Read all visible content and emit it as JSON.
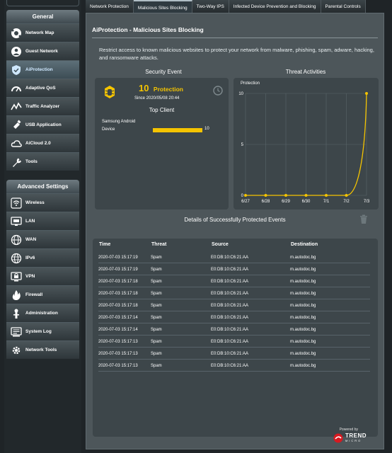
{
  "sidebar": {
    "general_title": "General",
    "general_items": [
      {
        "label": "Network Map",
        "icon": "network-map-icon"
      },
      {
        "label": "Guest Network",
        "icon": "guest-network-icon"
      },
      {
        "label": "AiProtection",
        "icon": "aiprotection-icon"
      },
      {
        "label": "Adaptive QoS",
        "icon": "qos-gauge-icon"
      },
      {
        "label": "Traffic Analyzer",
        "icon": "traffic-analyzer-icon"
      },
      {
        "label": "USB Application",
        "icon": "usb-icon"
      },
      {
        "label": "AiCloud 2.0",
        "icon": "cloud-icon"
      },
      {
        "label": "Tools",
        "icon": "tools-icon"
      }
    ],
    "advanced_title": "Advanced Settings",
    "advanced_items": [
      {
        "label": "Wireless",
        "icon": "wireless-icon"
      },
      {
        "label": "LAN",
        "icon": "lan-icon"
      },
      {
        "label": "WAN",
        "icon": "wan-globe-icon"
      },
      {
        "label": "IPv6",
        "icon": "ipv6-icon"
      },
      {
        "label": "VPN",
        "icon": "vpn-icon"
      },
      {
        "label": "Firewall",
        "icon": "firewall-icon"
      },
      {
        "label": "Administration",
        "icon": "administration-icon"
      },
      {
        "label": "System Log",
        "icon": "system-log-icon"
      },
      {
        "label": "Network Tools",
        "icon": "network-tools-icon"
      }
    ]
  },
  "tabs": [
    "Network Protection",
    "Malicious Sites Blocking",
    "Two-Way IPS",
    "Infected Device Prevention and Blocking",
    "Parental Controls"
  ],
  "page": {
    "title": "AiProtection - Malicious Sites Blocking",
    "description": "Restrict access to known malicious websites to protect your network from malware, phishing, spam, adware, hacking, and ransomware attacks."
  },
  "security_event": {
    "heading": "Security Event",
    "count": "10",
    "count_label": "Protection",
    "since": "Since 2020/05/08 20:44",
    "top_client_heading": "Top Client",
    "client_name_line1": "Samsung Android",
    "client_name_line2": "Device",
    "client_value": 10,
    "client_max": 10
  },
  "threat_activities": {
    "heading": "Threat Activities"
  },
  "chart_data": {
    "type": "line",
    "title": "Protection",
    "categories": [
      "6/27",
      "6/28",
      "6/29",
      "6/30",
      "7/1",
      "7/2",
      "7/3"
    ],
    "series": [
      {
        "values": [
          0,
          0,
          0,
          0,
          0,
          0,
          10
        ]
      }
    ],
    "yticks": [
      "0",
      "5",
      "10"
    ],
    "ylim": [
      0,
      10
    ],
    "grid": true
  },
  "details": {
    "heading": "Details of Successfully Protected Events",
    "columns": [
      "Time",
      "Threat",
      "Source",
      "Destination"
    ],
    "rows": [
      [
        "2020-07-03 15:17:19",
        "Spam",
        "E0:DB:10:C6:21:AA",
        "m.autodoc.bg"
      ],
      [
        "2020-07-03 15:17:19",
        "Spam",
        "E0:DB:10:C6:21:AA",
        "m.autodoc.bg"
      ],
      [
        "2020-07-03 15:17:18",
        "Spam",
        "E0:DB:10:C6:21:AA",
        "m.autodoc.bg"
      ],
      [
        "2020-07-03 15:17:18",
        "Spam",
        "E0:DB:10:C6:21:AA",
        "m.autodoc.bg"
      ],
      [
        "2020-07-03 15:17:18",
        "Spam",
        "E0:DB:10:C6:21:AA",
        "m.autodoc.bg"
      ],
      [
        "2020-07-03 15:17:14",
        "Spam",
        "E0:DB:10:C6:21:AA",
        "m.autodoc.bg"
      ],
      [
        "2020-07-03 15:17:14",
        "Spam",
        "E0:DB:10:C6:21:AA",
        "m.autodoc.bg"
      ],
      [
        "2020-07-03 15:17:13",
        "Spam",
        "E0:DB:10:C6:21:AA",
        "m.autodoc.bg"
      ],
      [
        "2020-07-03 15:17:13",
        "Spam",
        "E0:DB:10:C6:21:AA",
        "m.autodoc.bg"
      ],
      [
        "2020-07-03 15:17:13",
        "Spam",
        "E0:DB:10:C6:21:AA",
        "m.autodoc.bg"
      ]
    ]
  },
  "footer": {
    "powered_by": "Powered by",
    "brand": "TREND",
    "brand_sub": "MICRO"
  },
  "colors": {
    "accent_yellow": "#f5c400",
    "active_label": "#cfe8ff",
    "brand_red": "#d71920"
  }
}
